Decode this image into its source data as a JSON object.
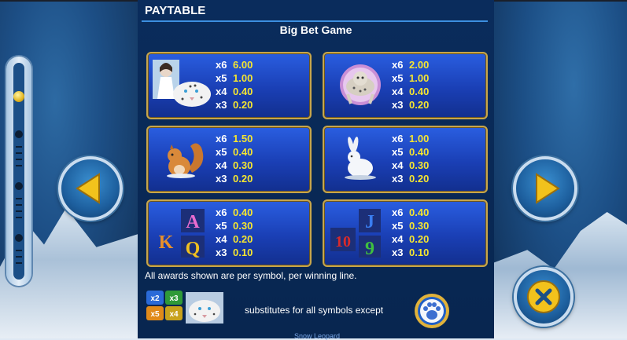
{
  "header": {
    "title": "PAYTABLE",
    "subtitle": "Big Bet Game"
  },
  "cards": [
    {
      "symbol": "huntress-and-snow-leopard",
      "pays": [
        {
          "k": "x6",
          "v": "6.00"
        },
        {
          "k": "x5",
          "v": "1.00"
        },
        {
          "k": "x4",
          "v": "0.40"
        },
        {
          "k": "x3",
          "v": "0.20"
        }
      ]
    },
    {
      "symbol": "leaping-snow-leopard",
      "pays": [
        {
          "k": "x6",
          "v": "2.00"
        },
        {
          "k": "x5",
          "v": "1.00"
        },
        {
          "k": "x4",
          "v": "0.40"
        },
        {
          "k": "x3",
          "v": "0.20"
        }
      ]
    },
    {
      "symbol": "squirrel",
      "pays": [
        {
          "k": "x6",
          "v": "1.50"
        },
        {
          "k": "x5",
          "v": "0.40"
        },
        {
          "k": "x4",
          "v": "0.30"
        },
        {
          "k": "x3",
          "v": "0.20"
        }
      ]
    },
    {
      "symbol": "snow-hare",
      "pays": [
        {
          "k": "x6",
          "v": "1.00"
        },
        {
          "k": "x5",
          "v": "0.40"
        },
        {
          "k": "x4",
          "v": "0.30"
        },
        {
          "k": "x3",
          "v": "0.20"
        }
      ]
    },
    {
      "symbol": "card-royals",
      "letters": [
        "K",
        "A",
        "Q"
      ],
      "pays": [
        {
          "k": "x6",
          "v": "0.40"
        },
        {
          "k": "x5",
          "v": "0.30"
        },
        {
          "k": "x4",
          "v": "0.20"
        },
        {
          "k": "x3",
          "v": "0.10"
        }
      ]
    },
    {
      "symbol": "card-numbers",
      "letters": [
        "10",
        "J",
        "9"
      ],
      "pays": [
        {
          "k": "x6",
          "v": "0.40"
        },
        {
          "k": "x5",
          "v": "0.30"
        },
        {
          "k": "x4",
          "v": "0.20"
        },
        {
          "k": "x3",
          "v": "0.10"
        }
      ]
    }
  ],
  "footer": {
    "note": "All awards shown are per symbol, per winning line.",
    "wild_multipliers": [
      "x2",
      "x3",
      "x5",
      "x4"
    ],
    "substitutes_text": "substitutes for all symbols except",
    "wild_label": "Snow Leopard"
  },
  "colors": {
    "card_border": "#c8a64a",
    "pay_value": "#f4e531",
    "panel": "#0a2c5c",
    "rule": "#3c8fe0"
  }
}
